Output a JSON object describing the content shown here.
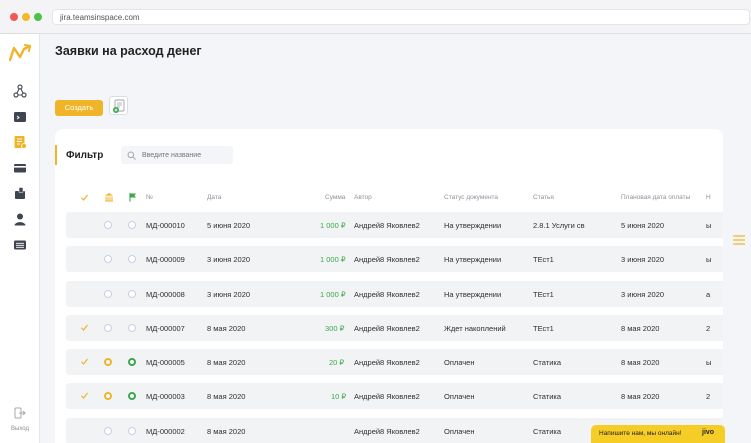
{
  "browser": {
    "url": "jira.teamsinspace.com"
  },
  "page": {
    "title": "Заявки на расход денег"
  },
  "toolbar": {
    "create_label": "Создать"
  },
  "filter": {
    "title": "Фильтр",
    "search_placeholder": "Введите название"
  },
  "table": {
    "headers": {
      "number": "№",
      "date": "Дата",
      "sum": "Сумма",
      "author": "Автор",
      "status": "Статус документа",
      "article": "Статья",
      "planned": "Плановая дата оплаты",
      "extra": "Н"
    },
    "rows": [
      {
        "number": "МД-000010",
        "date": "5 июня 2020",
        "sum": "1 000 ₽",
        "author": "Андрей8 Яковлев2",
        "status": "На утверждении",
        "article": "2.8.1 Услуги св",
        "planned": "5 июня 2020",
        "extra": "ы"
      },
      {
        "number": "МД-000009",
        "date": "3 июня 2020",
        "sum": "1 000 ₽",
        "author": "Андрей8 Яковлев2",
        "status": "На утверждении",
        "article": "ТЕст1",
        "planned": "3 июня 2020",
        "extra": "ы"
      },
      {
        "number": "МД-000008",
        "date": "3 июня 2020",
        "sum": "1 000 ₽",
        "author": "Андрей8 Яковлев2",
        "status": "На утверждении",
        "article": "ТЕст1",
        "planned": "3 июня 2020",
        "extra": "а"
      },
      {
        "number": "МД-000007",
        "date": "8 мая 2020",
        "sum": "300 ₽",
        "author": "Андрей8 Яковлев2",
        "status": "Ждет накоплений",
        "article": "ТЕст1",
        "planned": "8 мая 2020",
        "extra": "2"
      },
      {
        "number": "МД-000005",
        "date": "8 мая 2020",
        "sum": "20 ₽",
        "author": "Андрей8 Яковлев2",
        "status": "Оплачен",
        "article": "Статика",
        "planned": "8 мая 2020",
        "extra": "ы"
      },
      {
        "number": "МД-000003",
        "date": "8 мая 2020",
        "sum": "10 ₽",
        "author": "Андрей8 Яковлев2",
        "status": "Оплачен",
        "article": "Статика",
        "planned": "8 мая 2020",
        "extra": "2"
      },
      {
        "number": "МД-000002",
        "date": "8 мая 2020",
        "sum": "",
        "author": "Андрей8 Яковлев2",
        "status": "Оплачен",
        "article": "Статика",
        "planned": "",
        "extra": ""
      }
    ]
  },
  "sidebar": {
    "exit_label": "Выход"
  },
  "chat": {
    "text": "Напишите нам, мы онлайн!",
    "brand": "jivo"
  },
  "colors": {
    "accent": "#f0b429",
    "green": "#3aa84a",
    "ring": "#c9cde8"
  },
  "icons": {
    "sidebar": [
      "logo-icon",
      "triangle-nodes-icon",
      "terminal-icon",
      "document-rub-icon",
      "credit-card-icon",
      "wallet-icon",
      "user-icon",
      "list-card-icon",
      "exit-icon"
    ],
    "misc": [
      "excel-export-icon",
      "search-icon",
      "check-icon",
      "bank-icon",
      "flag-icon",
      "hamburger-icon"
    ]
  }
}
